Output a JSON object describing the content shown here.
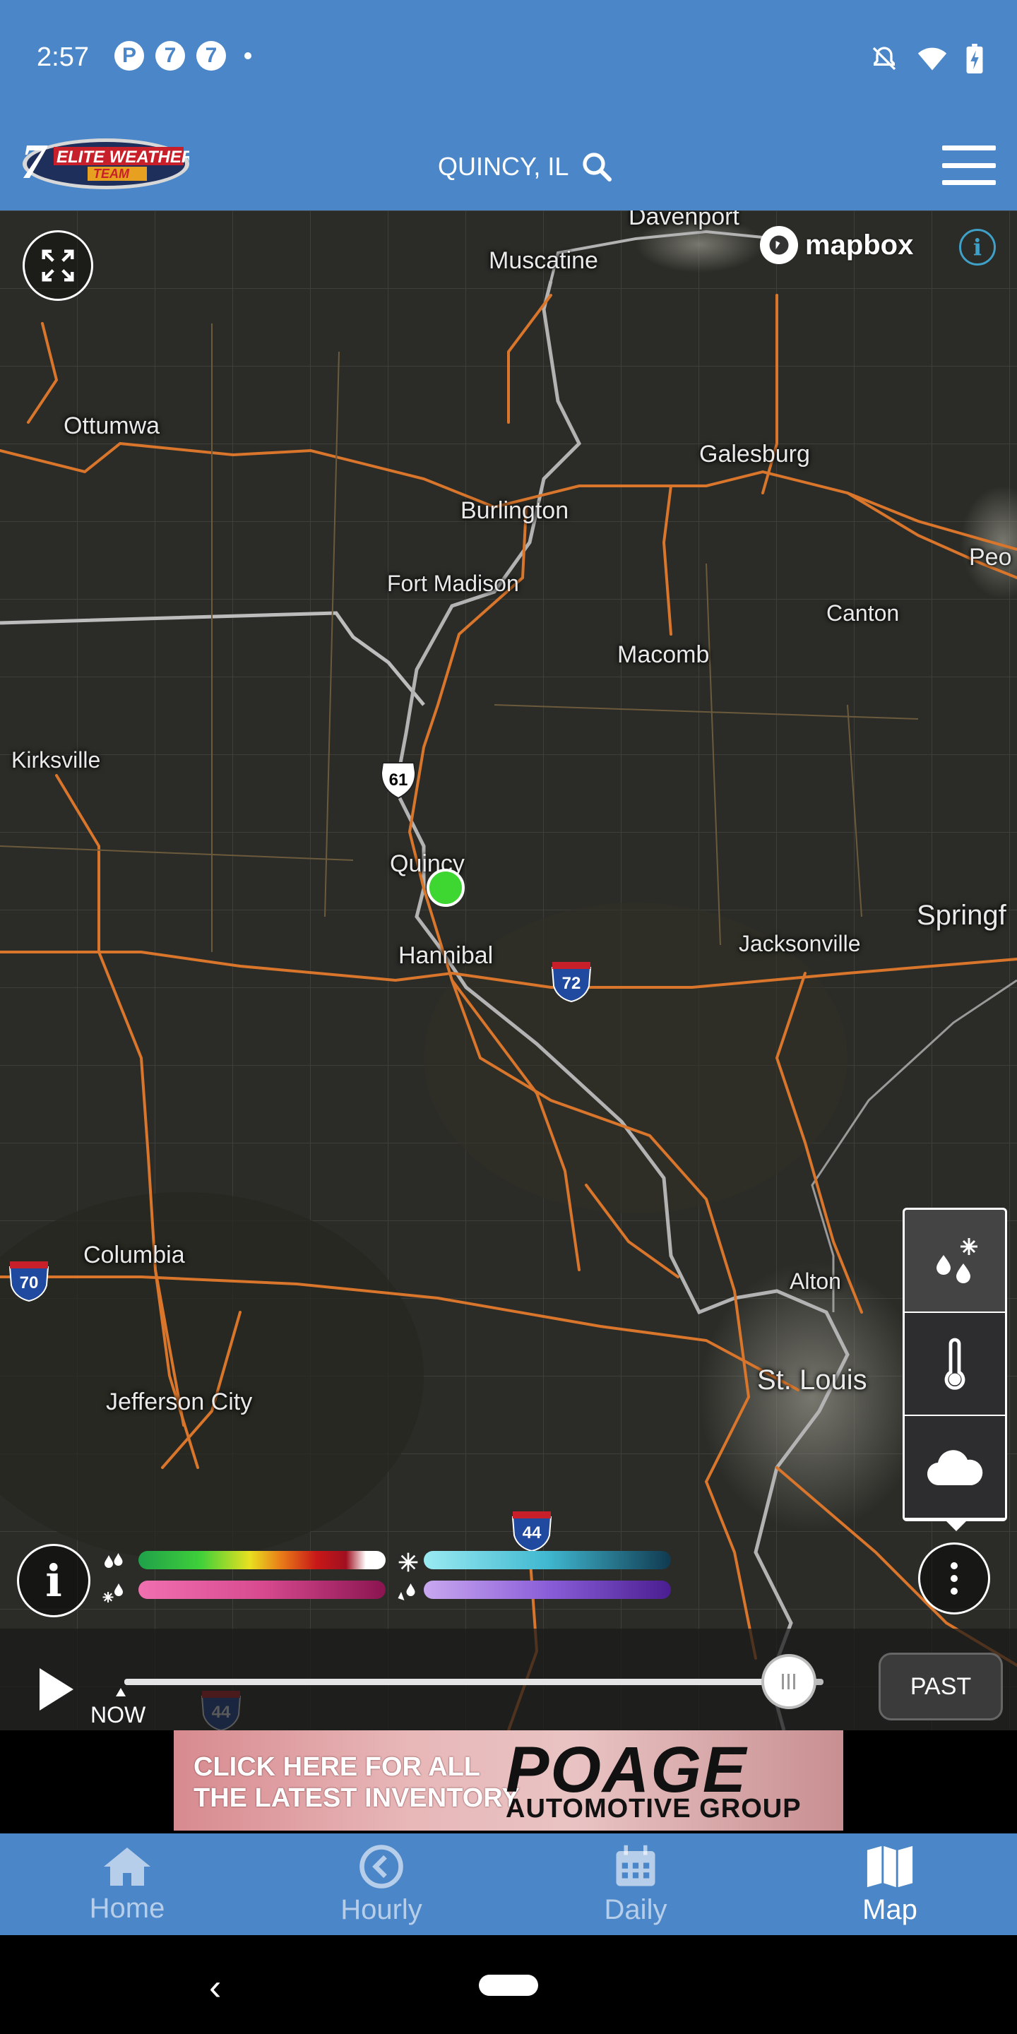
{
  "status_bar": {
    "time": "2:57",
    "notif_1": "P",
    "notif_2": "7",
    "notif_3": "7"
  },
  "header": {
    "logo_line1": "7ELITE WEATHER",
    "logo_line2": "TEAM",
    "location": "QUINCY, IL"
  },
  "map": {
    "attribution": "mapbox",
    "cities": [
      {
        "name": "Davenport"
      },
      {
        "name": "Muscatine"
      },
      {
        "name": "Ottumwa"
      },
      {
        "name": "Galesburg"
      },
      {
        "name": "Burlington"
      },
      {
        "name": "Peo"
      },
      {
        "name": "Fort Madison"
      },
      {
        "name": "Canton"
      },
      {
        "name": "Macomb"
      },
      {
        "name": "Kirksville"
      },
      {
        "name": "Quincy"
      },
      {
        "name": "Springf"
      },
      {
        "name": "Jacksonville"
      },
      {
        "name": "Hannibal"
      },
      {
        "name": "Columbia"
      },
      {
        "name": "Alton"
      },
      {
        "name": "St. Louis"
      },
      {
        "name": "Jefferson City"
      }
    ],
    "highway_shields": [
      {
        "num": "61"
      },
      {
        "num": "72"
      },
      {
        "num": "70"
      },
      {
        "num": "44"
      },
      {
        "num": "44"
      }
    ]
  },
  "timeline": {
    "now_label": "NOW",
    "past_button": "PAST",
    "progress": 0.95
  },
  "ad": {
    "line1": "CLICK HERE FOR ALL",
    "line2": "THE LATEST INVENTORY",
    "brand": "POAGE",
    "brand_sub": "AUTOMOTIVE GROUP"
  },
  "nav": {
    "home": "Home",
    "hourly": "Hourly",
    "daily": "Daily",
    "map": "Map"
  },
  "colors": {
    "brand_blue": "#4a86c8",
    "location_dot": "#3ed630",
    "road": "#e07a2e"
  }
}
